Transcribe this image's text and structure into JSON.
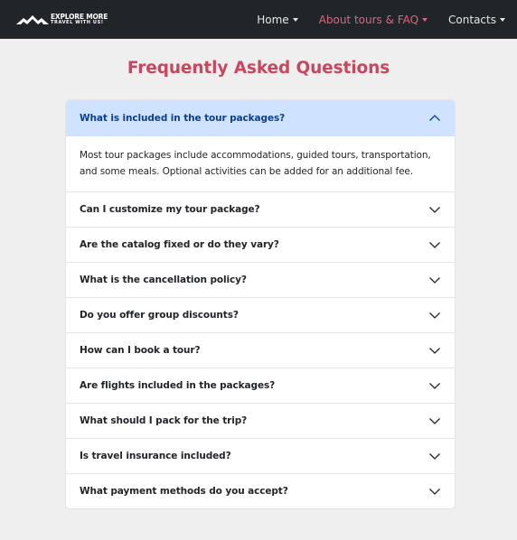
{
  "brand": {
    "line1": "EXPLORE MORE",
    "line2": "TRAVEL WITH US!",
    "logo_icon": "mountain-logo-icon"
  },
  "nav": {
    "items": [
      {
        "label": "Home",
        "active": false,
        "has_dropdown": true
      },
      {
        "label": "About tours & FAQ",
        "active": true,
        "has_dropdown": true
      },
      {
        "label": "Contacts",
        "active": false,
        "has_dropdown": true
      }
    ],
    "active_color": "#e0637f"
  },
  "faq": {
    "title": "Frequently Asked Questions",
    "title_color": "#c9475e",
    "items": [
      {
        "question": "What is included in the tour packages?",
        "answer": "Most tour packages include accommodations, guided tours, transportation, and some meals. Optional activities can be added for an additional fee.",
        "expanded": true
      },
      {
        "question": "Can I customize my tour package?",
        "expanded": false
      },
      {
        "question": "Are the catalog fixed or do they vary?",
        "expanded": false
      },
      {
        "question": "What is the cancellation policy?",
        "expanded": false
      },
      {
        "question": "Do you offer group discounts?",
        "expanded": false
      },
      {
        "question": "How can I book a tour?",
        "expanded": false
      },
      {
        "question": "Are flights included in the packages?",
        "expanded": false
      },
      {
        "question": "What should I pack for the trip?",
        "expanded": false
      },
      {
        "question": "Is travel insurance included?",
        "expanded": false
      },
      {
        "question": "What payment methods do you accept?",
        "expanded": false
      }
    ],
    "open_header_color": "#cfe2ff",
    "icons": {
      "expanded": "chevron-up-icon",
      "collapsed": "chevron-down-icon"
    }
  }
}
